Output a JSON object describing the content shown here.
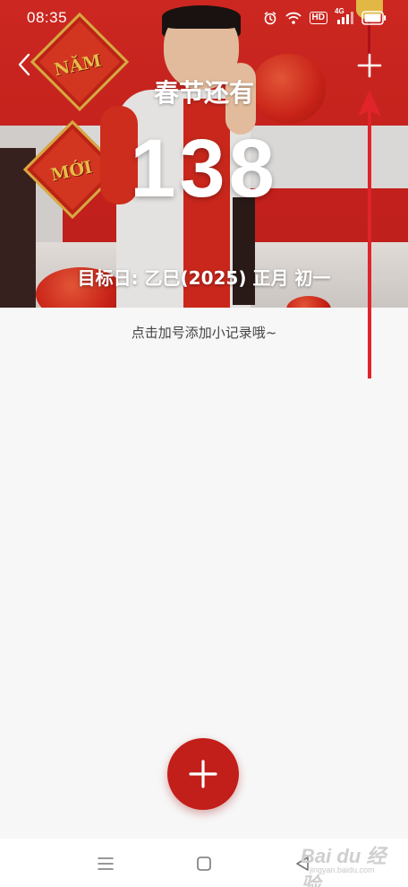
{
  "status_bar": {
    "time": "08:35",
    "icons": [
      "alarm-icon",
      "wifi-icon",
      "hd-icon",
      "signal-4g-icon",
      "battery-icon"
    ],
    "hd_label": "HD",
    "network_label": "4G"
  },
  "header": {
    "back_icon": "chevron-left-icon",
    "add_icon": "plus-icon"
  },
  "hero": {
    "banner_1": "NĂM",
    "banner_2": "MỚI"
  },
  "countdown": {
    "title": "春节还有",
    "days": "138",
    "target_date": "目标日: 乙巳(2025) 正月 初一"
  },
  "content": {
    "hint": "点击加号添加小记录哦~"
  },
  "fab": {
    "icon": "plus-icon"
  },
  "system_nav": {
    "icons": [
      "menu-icon",
      "home-icon",
      "back-triangle-icon"
    ]
  },
  "watermark": {
    "main": "Bai du 经验",
    "sub": "jingyan.baidu.com"
  },
  "colors": {
    "accent": "#c21e1a",
    "background": "#f7f7f7",
    "annotation": "#e0242a"
  }
}
